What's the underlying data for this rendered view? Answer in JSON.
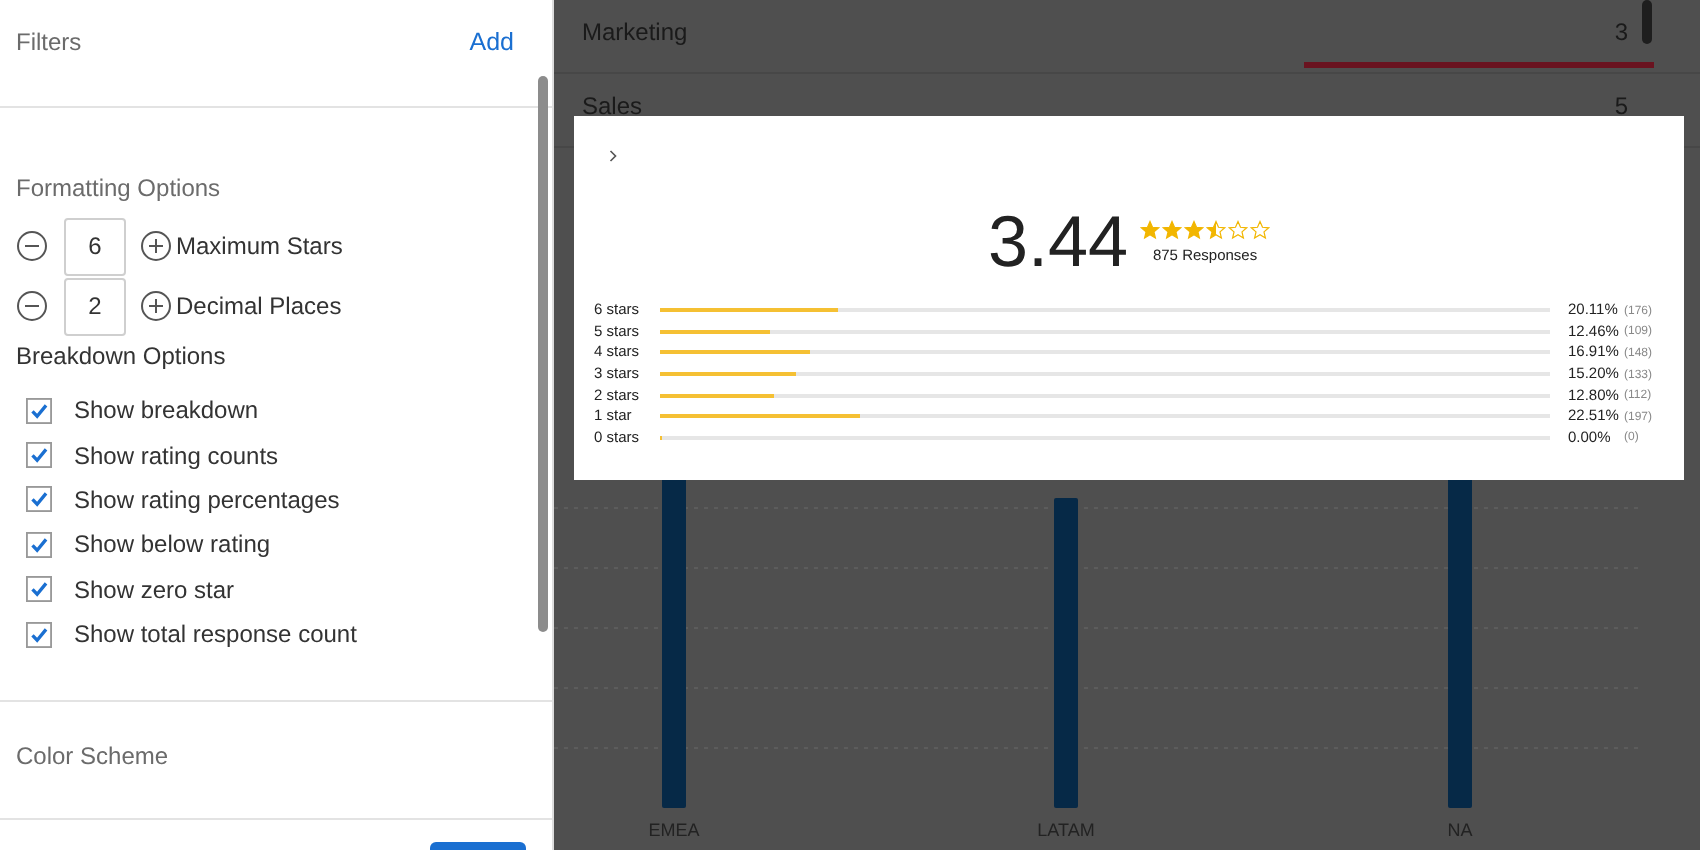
{
  "filters": {
    "title": "Filters",
    "add_link": "Add"
  },
  "formatting": {
    "title": "Formatting Options",
    "steppers": [
      {
        "value": "6",
        "label": "Maximum Stars"
      },
      {
        "value": "2",
        "label": "Decimal Places"
      }
    ]
  },
  "breakdown_options": {
    "title": "Breakdown Options",
    "options": [
      {
        "label": "Show breakdown",
        "checked": true
      },
      {
        "label": "Show rating counts",
        "checked": true
      },
      {
        "label": "Show rating percentages",
        "checked": true
      },
      {
        "label": "Show below rating",
        "checked": true
      },
      {
        "label": "Show zero star",
        "checked": true
      },
      {
        "label": "Show total response count",
        "checked": true
      }
    ]
  },
  "color_scheme": {
    "title": "Color Scheme"
  },
  "background": {
    "rows": [
      {
        "name": "Marketing",
        "count": "3"
      },
      {
        "name": "Sales",
        "count": "5"
      }
    ],
    "categories": [
      "EMEA",
      "LATAM",
      "NA"
    ]
  },
  "rating_card": {
    "score": "3.44",
    "stars": 3.5,
    "responses": "875 Responses",
    "rows": [
      {
        "label": "6 stars",
        "level": 0.2011,
        "percent": "20.11%",
        "count": "(176)"
      },
      {
        "label": "5 stars",
        "level": 0.1246,
        "percent": "12.46%",
        "count": "(109)"
      },
      {
        "label": "4 stars",
        "level": 0.1691,
        "percent": "16.91%",
        "count": "(148)"
      },
      {
        "label": "3 stars",
        "level": 0.152,
        "percent": "15.20%",
        "count": "(133)"
      },
      {
        "label": "2 stars",
        "level": 0.128,
        "percent": "12.80%",
        "count": "(112)"
      },
      {
        "label": "1 star",
        "level": 0.2251,
        "percent": "22.51%",
        "count": "(197)"
      },
      {
        "label": "0 stars",
        "level": 0,
        "percent": "0.00%",
        "count": "(0)"
      }
    ]
  }
}
